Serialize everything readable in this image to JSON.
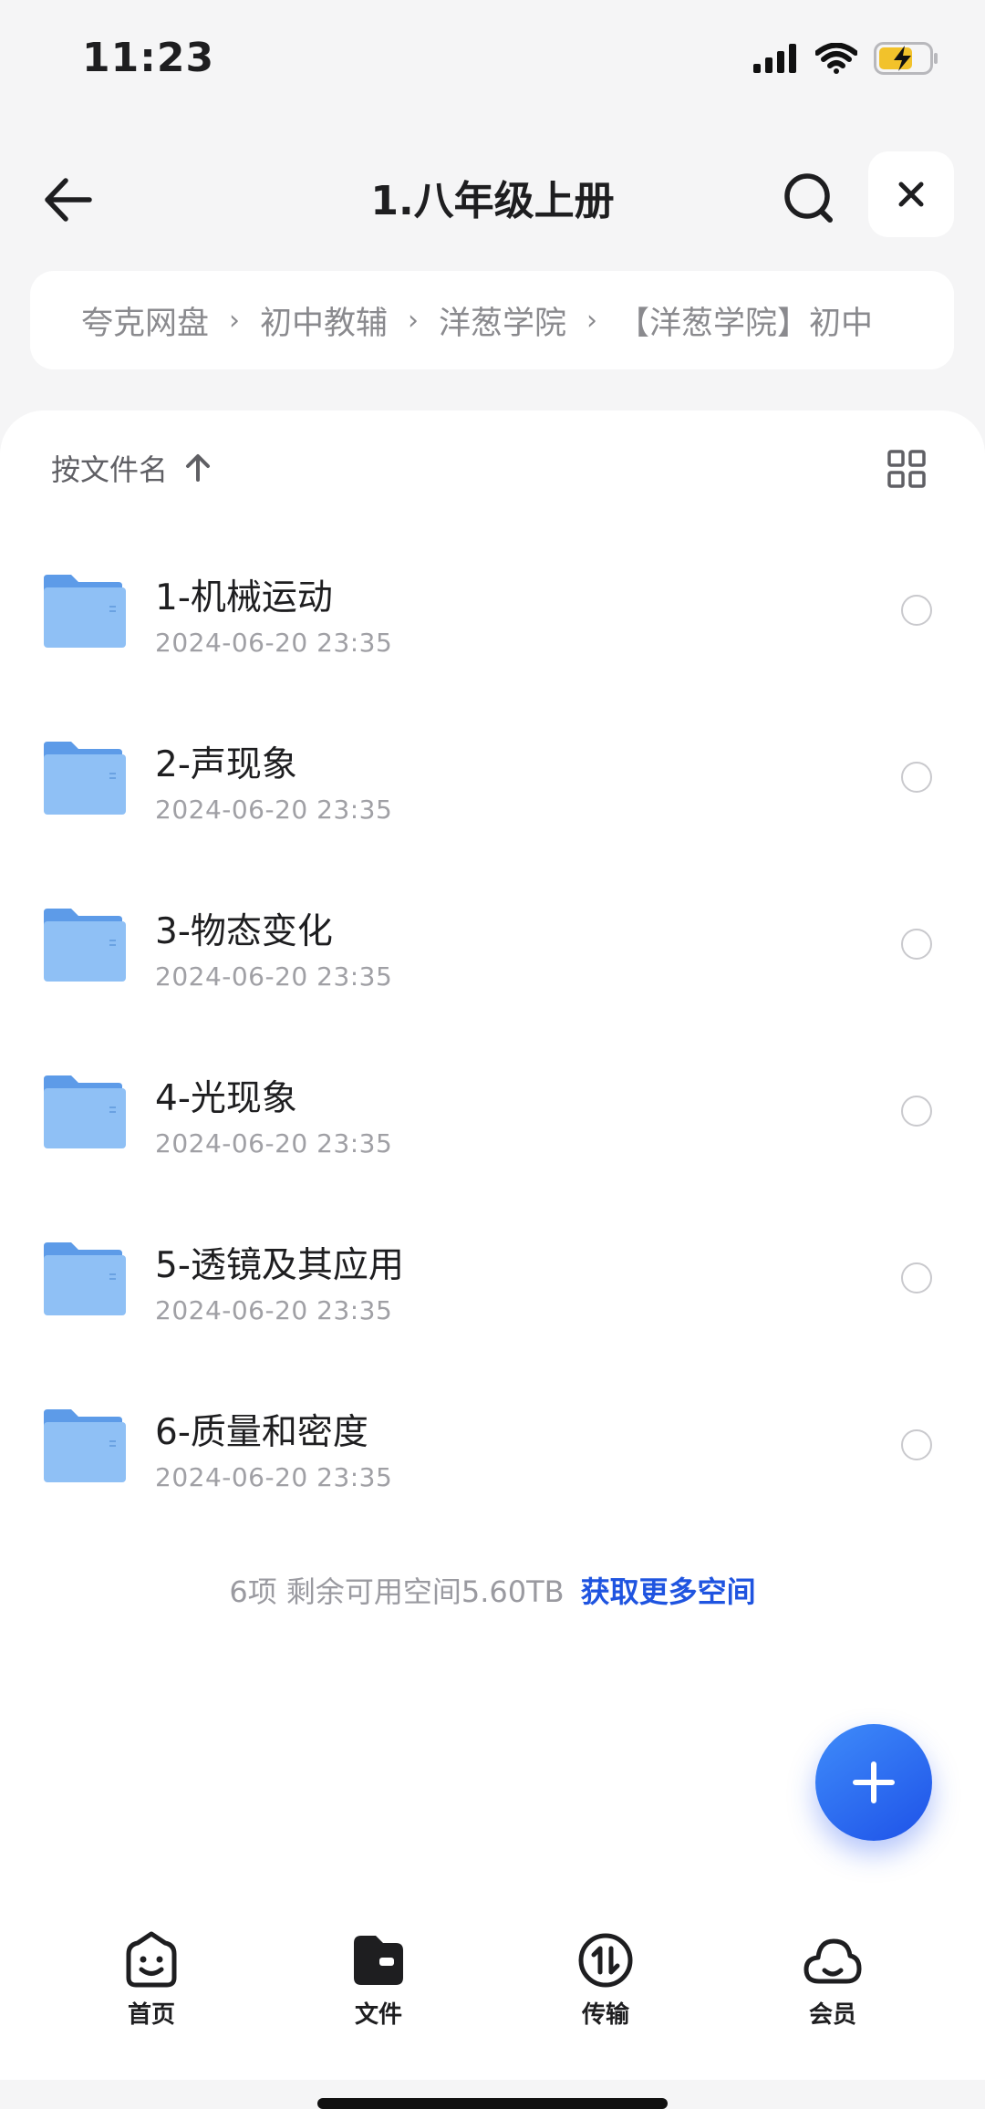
{
  "status_bar": {
    "time": "11:23"
  },
  "header": {
    "title": "1.八年级上册"
  },
  "breadcrumb": {
    "items": [
      "夸克网盘",
      "初中教辅",
      "洋葱学院",
      "【洋葱学院】初中"
    ],
    "separator": "›"
  },
  "sort": {
    "label": "按文件名",
    "direction_icon": "arrow-up-icon"
  },
  "files": [
    {
      "name": "1-机械运动",
      "date": "2024-06-20 23:35"
    },
    {
      "name": "2-声现象",
      "date": "2024-06-20 23:35"
    },
    {
      "name": "3-物态变化",
      "date": "2024-06-20 23:35"
    },
    {
      "name": "4-光现象",
      "date": "2024-06-20 23:35"
    },
    {
      "name": "5-透镜及其应用",
      "date": "2024-06-20 23:35"
    },
    {
      "name": "6-质量和密度",
      "date": "2024-06-20 23:35"
    }
  ],
  "footer": {
    "summary": "6项 剩余可用空间5.60TB",
    "link": "获取更多空间"
  },
  "bottom_nav": [
    {
      "label": "首页",
      "icon": "smile-home-icon"
    },
    {
      "label": "文件",
      "icon": "folder-tab-icon"
    },
    {
      "label": "传输",
      "icon": "transfer-icon"
    },
    {
      "label": "会员",
      "icon": "cloud-icon"
    }
  ],
  "colors": {
    "accent": "#1f54e0",
    "folder": "#6aa8f0",
    "background": "#f5f5f6"
  }
}
